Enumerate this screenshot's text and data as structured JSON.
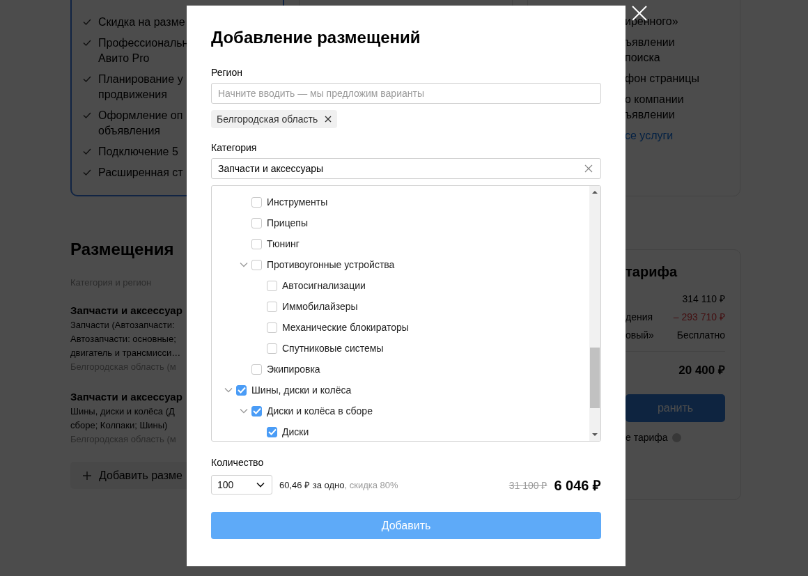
{
  "background": {
    "tariff_card": {
      "features": [
        {
          "lines": [
            "Скидка на разме"
          ]
        },
        {
          "lines": [
            "Профессиональн",
            "Авито Pro"
          ]
        },
        {
          "lines": [
            "Планирование у",
            "продвижения"
          ]
        },
        {
          "lines": [
            "Оформление оп",
            "объявления"
          ]
        },
        {
          "lines": [
            "Подключение 5"
          ]
        },
        {
          "lines": [
            "Расширенная ст"
          ]
        }
      ]
    },
    "services_card": {
      "features": [
        {
          "lines": [
            "иренного»"
          ]
        },
        {
          "lines": [
            "ъявлении",
            "поиска"
          ]
        },
        {
          "lines": [
            "фон страницы"
          ]
        },
        {
          "lines": [
            "о компании",
            "ъявлении"
          ]
        }
      ],
      "link": "се услуги"
    },
    "placements": {
      "title": "Размещения",
      "subtitle": "Категория и регион",
      "items": [
        {
          "title": "Запчасти и аксессуар",
          "lines": [
            "Запчасти (Автозапчасти:",
            "Автозапчасти: основные;",
            "двигатель и трансмисси…"
          ],
          "region": "Белгородская область (м"
        },
        {
          "title": "Запчасти и аксессуар",
          "lines": [
            "Шины, диски и колёса (Д",
            "сборе; Колпаки; Шины)"
          ],
          "region": "Белгородская область (м"
        }
      ],
      "add_button": "Добавить разме"
    },
    "summary": {
      "title": "тарифа",
      "rows": [
        {
          "value": "314 110 ₽",
          "kind": "normal"
        },
        {
          "label": "дения",
          "value": "– 293 710 ₽",
          "kind": "discount"
        },
        {
          "label": "овый»",
          "value": "Бесплатно",
          "kind": "normal"
        }
      ],
      "total": "20 400 ₽",
      "button": "ранить",
      "note": "е тарифа"
    }
  },
  "modal": {
    "title": "Добавление размещений",
    "region": {
      "label": "Регион",
      "placeholder": "Начните вводить — мы предложим варианты",
      "chips": [
        {
          "label": "Белгородская область"
        }
      ]
    },
    "category": {
      "label": "Категория",
      "value": "Запчасти и аксессуары"
    },
    "category_tree": [
      {
        "children": [
          {
            "label": "Инструменты",
            "checked": false
          },
          {
            "label": "Прицепы",
            "checked": false
          },
          {
            "label": "Тюнинг",
            "checked": false
          },
          {
            "label": "Противоугонные устройства",
            "checked": false,
            "expanded": true,
            "children": [
              {
                "label": "Автосигнализации",
                "checked": false
              },
              {
                "label": "Иммобилайзеры",
                "checked": false
              },
              {
                "label": "Механические блокираторы",
                "checked": false
              },
              {
                "label": "Спутниковые системы",
                "checked": false
              }
            ]
          },
          {
            "label": "Экипировка",
            "checked": false
          }
        ]
      },
      {
        "label": "Шины, диски и колёса",
        "checked": true,
        "expanded": true,
        "children": [
          {
            "label": "Диски и колёса в сборе",
            "checked": true,
            "expanded": true,
            "children": [
              {
                "label": "Диски",
                "checked": true
              }
            ]
          }
        ]
      }
    ],
    "quantity": {
      "label": "Количество",
      "value": "100",
      "price_per_unit": "60,46 ₽ за одно",
      "discount": ", скидка 80%",
      "old_price": "31 100 ₽",
      "price": "6 046 ₽"
    },
    "submit_button": "Добавить"
  }
}
